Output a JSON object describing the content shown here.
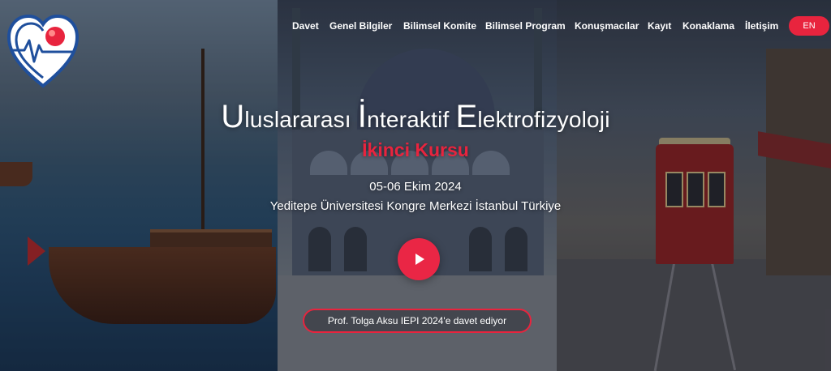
{
  "brand": {
    "logo_icon": "heart-ecg-logo-icon",
    "colors": {
      "accent": "#e8243e",
      "logo_blue": "#1f4f9c"
    }
  },
  "nav": {
    "items": [
      {
        "label": "Davet"
      },
      {
        "label": "Genel Bilgiler"
      },
      {
        "label": "Bilimsel Komite"
      },
      {
        "label": "Bilimsel Program"
      },
      {
        "label": "Konuşmacılar"
      },
      {
        "label": "Kayıt"
      },
      {
        "label": "Konaklama"
      },
      {
        "label": "İletişim"
      }
    ],
    "lang_label": "EN"
  },
  "hero": {
    "title_parts": [
      {
        "initial": "U",
        "rest": "luslararası "
      },
      {
        "initial": "İ",
        "rest": "nteraktif "
      },
      {
        "initial": "E",
        "rest": "lektrofizyoloji"
      }
    ],
    "subtitle": "İkinci Kursu",
    "dates": "05-06 Ekim 2024",
    "venue": "Yeditepe Üniversitesi Kongre Merkezi İstanbul Türkiye",
    "play_icon": "play-icon",
    "invite_label": "Prof. Tolga Aksu IEPI 2024'e davet ediyor"
  }
}
